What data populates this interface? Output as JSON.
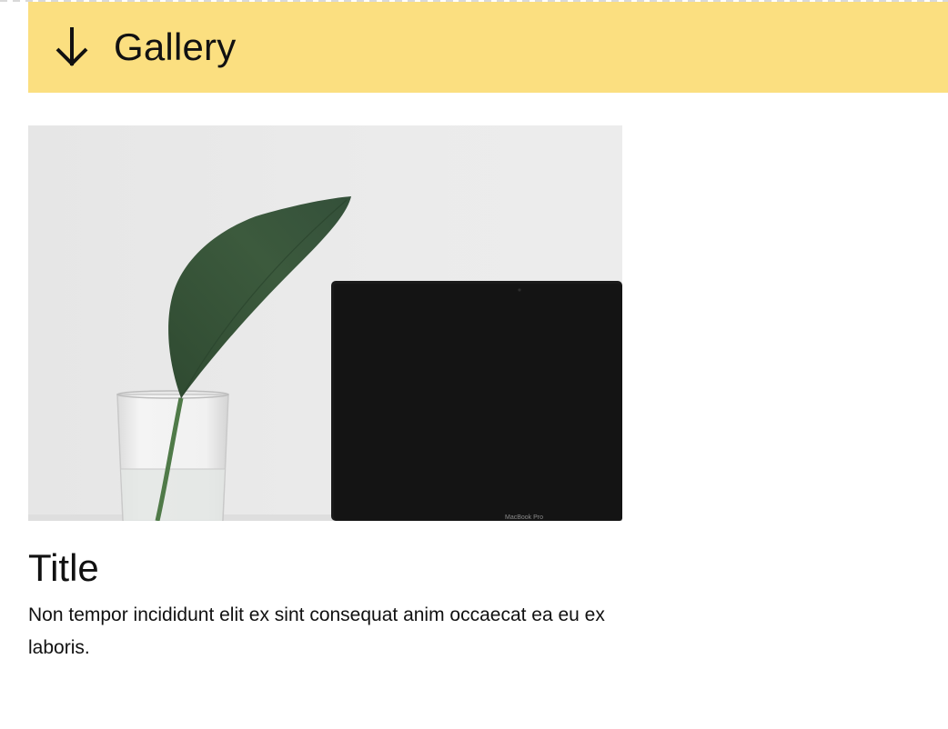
{
  "header": {
    "icon": "arrow-down-icon",
    "title": "Gallery",
    "background": "#fbdf80"
  },
  "card": {
    "image": {
      "subject": "leaf-in-glass-and-laptop",
      "laptop_label": "MacBook Pro"
    },
    "title": "Title",
    "body": "Non tempor incididunt elit ex sint consequat anim occaecat ea eu ex laboris."
  }
}
